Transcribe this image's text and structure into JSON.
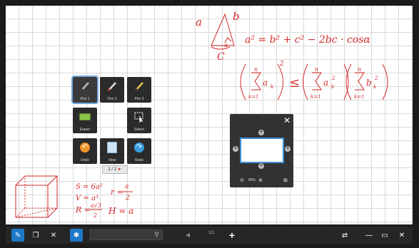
{
  "palette": {
    "tools": [
      {
        "label": "Pen 1",
        "icon": "pen-icon"
      },
      {
        "label": "Pen 2",
        "icon": "pen-icon"
      },
      {
        "label": "Pen 3",
        "icon": "pen-icon"
      },
      {
        "label": "Eraser",
        "icon": "eraser-icon"
      },
      {
        "label": "Select",
        "icon": "select-icon"
      },
      {
        "label": "Undo",
        "icon": "undo-icon"
      },
      {
        "label": "View",
        "icon": "view-icon"
      },
      {
        "label": "Redo",
        "icon": "redo-icon"
      }
    ],
    "page": "1 / 2",
    "page_arrow": "►"
  },
  "magnifier": {
    "close": "✕",
    "zoom_level": "80%"
  },
  "ink": {
    "tri_a": "a",
    "tri_b": "b",
    "tri_c": "C",
    "tri_angle": "α",
    "law_of_cosines": "a² = b² + c² − 2bc · cosα",
    "ineq_lhs_var": "a",
    "ineq_rhs_var1": "a",
    "ineq_rhs_var2": "b",
    "sum_top": "n",
    "sum_bottom": "k=1",
    "leq": "≤",
    "sub_k": "k",
    "sq": "2",
    "cube_s": "S = 6a²",
    "cube_v": "V = a³",
    "cube_r1": "r =",
    "cube_r1_num": "a",
    "cube_r1_den": "2",
    "cube_R": "R =",
    "cube_R_num": "a√3",
    "cube_R_den": "2",
    "cube_H": "H = a"
  },
  "taskbar": {
    "page_indicator": "1/1",
    "search_placeholder": ""
  },
  "colors": {
    "ink": "#d42a2a",
    "accent": "#1e78c8"
  }
}
